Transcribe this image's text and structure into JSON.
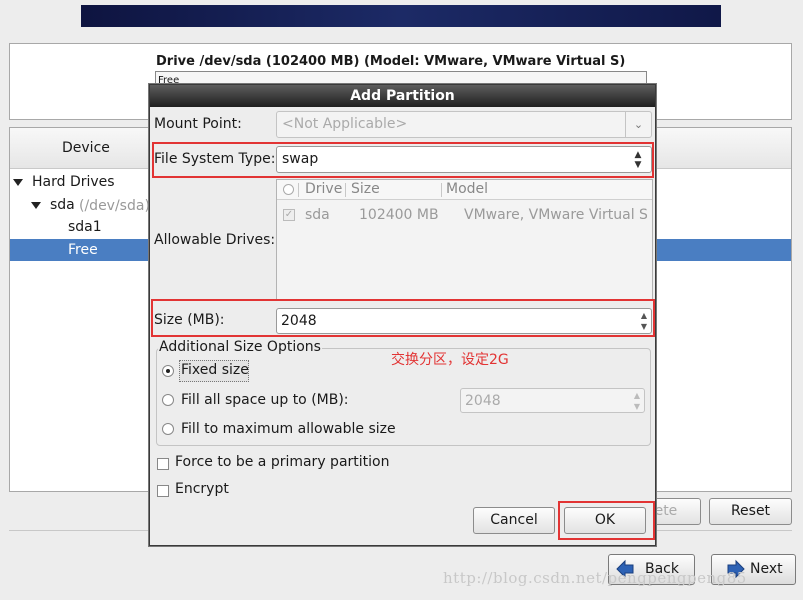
{
  "drive": {
    "title": "Drive /dev/sda (102400 MB) (Model: VMware, VMware Virtual S)",
    "bar_label": "Free"
  },
  "tree": {
    "column_header": "Device",
    "rows": [
      {
        "label": "Hard Drives"
      },
      {
        "label": "sda",
        "sub": "(/dev/sda)"
      },
      {
        "label": "sda1"
      },
      {
        "label": "Free"
      }
    ]
  },
  "dialog": {
    "title": "Add Partition",
    "mount_point_label": "Mount Point:",
    "mount_point_value": "<Not Applicable>",
    "fs_type_label": "File System Type:",
    "fs_type_value": "swap",
    "allowable_drives_label": "Allowable Drives:",
    "drives_columns": [
      "Drive",
      "Size",
      "Model"
    ],
    "drives_rows": [
      {
        "drive": "sda",
        "size": "102400 MB",
        "model": "VMware, VMware Virtual S",
        "checked": true
      }
    ],
    "size_label": "Size (MB):",
    "size_value": "2048",
    "size_options_title": "Additional Size Options",
    "fixed_size_label": "Fixed size",
    "fill_up_to_label": "Fill all space up to (MB):",
    "fill_up_to_value": "2048",
    "fill_max_label": "Fill to maximum allowable size",
    "primary_label": "Force to be a primary partition",
    "encrypt_label": "Encrypt",
    "cancel_label": "Cancel",
    "ok_label": "OK",
    "annotation": "交换分区，设定2G"
  },
  "actions": {
    "delete_label": "lete",
    "reset_label": "Reset",
    "back_label": "Back",
    "next_label": "Next"
  },
  "watermark": "http://blog.csdn.net/pengpengpeng85",
  "colors": {
    "selection": "#4a7ec2",
    "annotation": "#e23434",
    "dialog_title": "#1f1f1f",
    "nav_arrow": "#2d62b5"
  }
}
